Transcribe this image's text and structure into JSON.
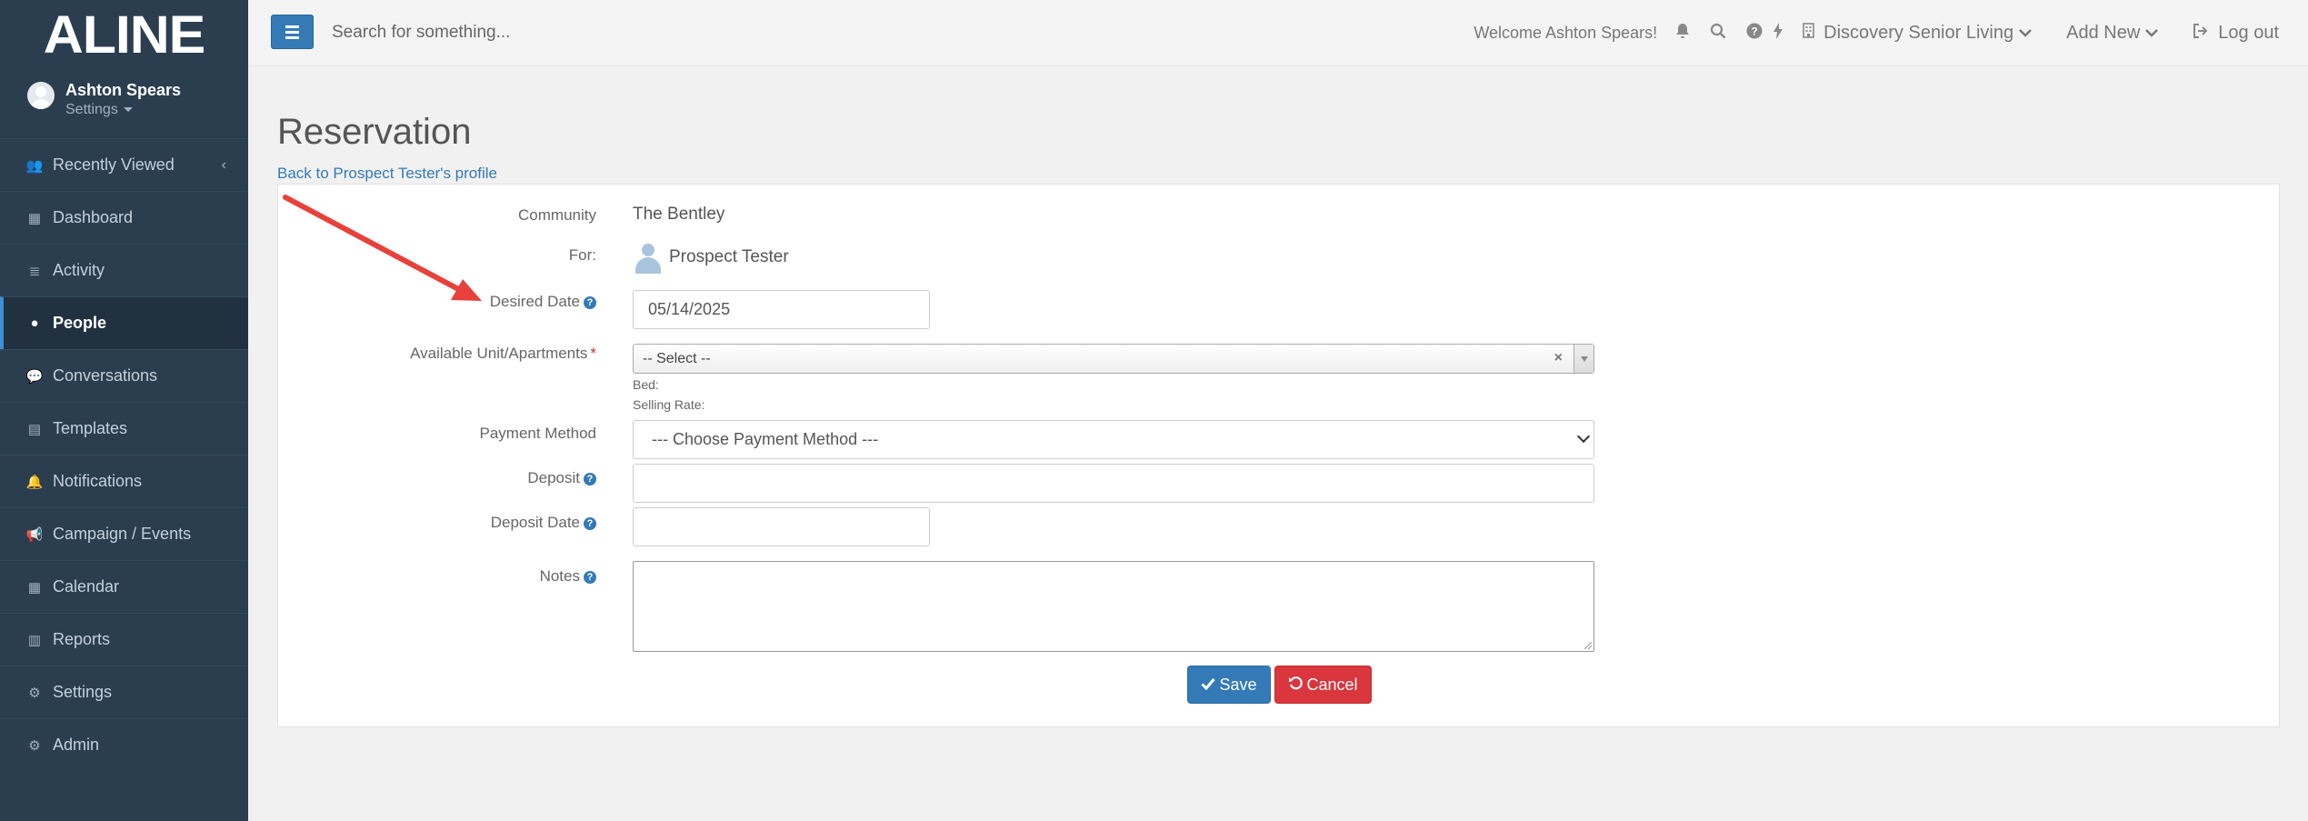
{
  "sidebar": {
    "logo": "ALINE",
    "user_name": "Ashton Spears",
    "user_settings": "Settings",
    "collapse_icon": "‹",
    "items": [
      {
        "label": "Recently Viewed",
        "icon": "users-icon",
        "glyph": "👥",
        "active": false
      },
      {
        "label": "Dashboard",
        "icon": "dashboard-icon",
        "glyph": "▦",
        "active": false
      },
      {
        "label": "Activity",
        "icon": "list-icon",
        "glyph": "≣",
        "active": false
      },
      {
        "label": "People",
        "icon": "person-icon",
        "glyph": "●",
        "active": true
      },
      {
        "label": "Conversations",
        "icon": "chat-icon",
        "glyph": "💬",
        "active": false
      },
      {
        "label": "Templates",
        "icon": "file-icon",
        "glyph": "▤",
        "active": false
      },
      {
        "label": "Notifications",
        "icon": "bell-icon",
        "glyph": "🔔",
        "active": false
      },
      {
        "label": "Campaign / Events",
        "icon": "bullhorn-icon",
        "glyph": "📢",
        "active": false
      },
      {
        "label": "Calendar",
        "icon": "calendar-icon",
        "glyph": "▦",
        "active": false
      },
      {
        "label": "Reports",
        "icon": "bar-chart-icon",
        "glyph": "▥",
        "active": false
      },
      {
        "label": "Settings",
        "icon": "gear-icon",
        "glyph": "⚙",
        "active": false
      },
      {
        "label": "Admin",
        "icon": "gears-icon",
        "glyph": "⚙",
        "active": false
      }
    ]
  },
  "topbar": {
    "search_placeholder": "Search for something...",
    "welcome": "Welcome Ashton Spears!",
    "community": "Discovery Senior Living",
    "add_new": "Add New",
    "logout": "Log out"
  },
  "page": {
    "title": "Reservation",
    "back_link": "Back to Prospect Tester's profile"
  },
  "form": {
    "community_label": "Community",
    "community_value": "The Bentley",
    "for_label": "For:",
    "for_value": "Prospect Tester",
    "desired_date_label": "Desired Date",
    "desired_date_value": "05/14/2025",
    "unit_label": "Available Unit/Apartments",
    "unit_required": "*",
    "unit_value": "-- Select --",
    "bed_label": "Bed:",
    "selling_rate_label": "Selling Rate:",
    "payment_label": "Payment Method",
    "payment_value": "--- Choose Payment Method ---",
    "deposit_label": "Deposit",
    "deposit_value": "",
    "deposit_date_label": "Deposit Date",
    "deposit_date_value": "",
    "notes_label": "Notes",
    "notes_value": "",
    "help_glyph": "?",
    "clear_glyph": "×"
  },
  "buttons": {
    "save": "Save",
    "cancel": "Cancel"
  },
  "colors": {
    "sidebar": "#2b3e50",
    "primary": "#337ab7",
    "danger": "#d9363e",
    "annotation_arrow": "#e8403a"
  }
}
